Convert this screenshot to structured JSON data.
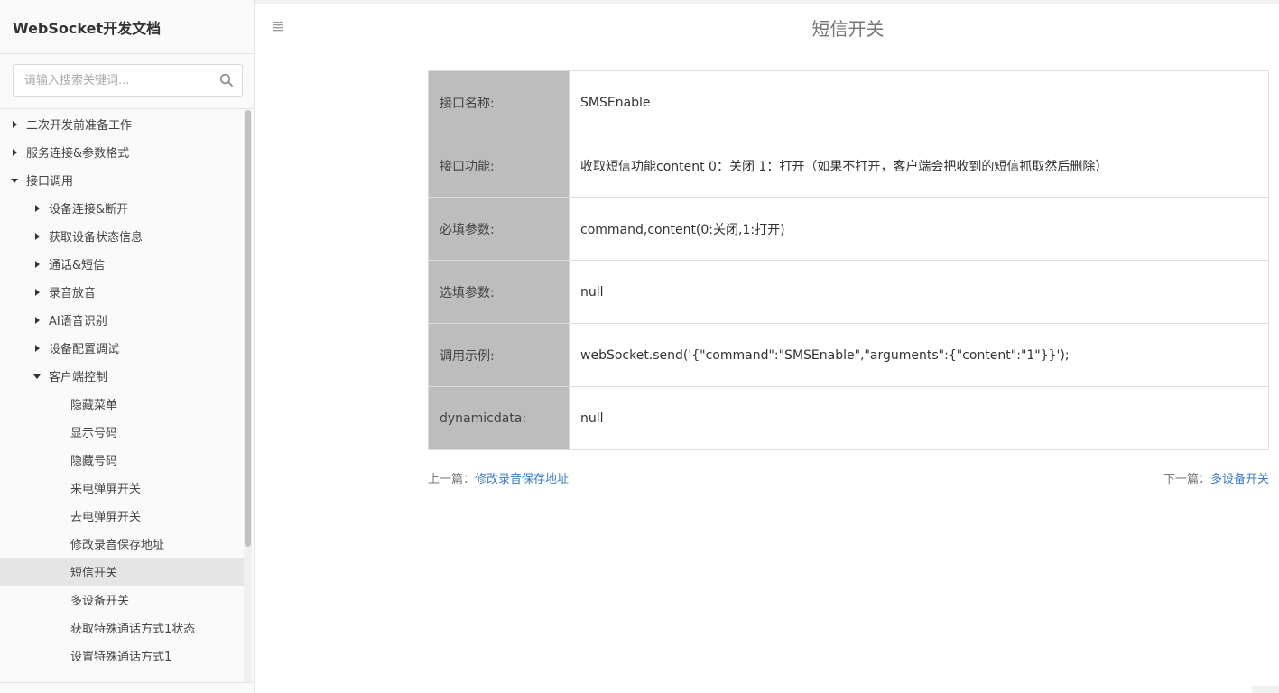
{
  "sidebar": {
    "title": "WebSocket开发文档",
    "search_placeholder": "请输入搜索关键词...",
    "items": [
      {
        "label": "二次开发前准备工作",
        "level": 0,
        "caret": "right"
      },
      {
        "label": "服务连接&参数格式",
        "level": 0,
        "caret": "right"
      },
      {
        "label": "接口调用",
        "level": 0,
        "caret": "down"
      },
      {
        "label": "设备连接&断开",
        "level": 1,
        "caret": "right"
      },
      {
        "label": "获取设备状态信息",
        "level": 1,
        "caret": "right"
      },
      {
        "label": "通话&短信",
        "level": 1,
        "caret": "right"
      },
      {
        "label": "录音放音",
        "level": 1,
        "caret": "right"
      },
      {
        "label": "AI语音识别",
        "level": 1,
        "caret": "right"
      },
      {
        "label": "设备配置调试",
        "level": 1,
        "caret": "right"
      },
      {
        "label": "客户端控制",
        "level": 1,
        "caret": "down"
      },
      {
        "label": "隐藏菜单",
        "level": 2,
        "caret": "none"
      },
      {
        "label": "显示号码",
        "level": 2,
        "caret": "none"
      },
      {
        "label": "隐藏号码",
        "level": 2,
        "caret": "none"
      },
      {
        "label": "来电弹屏开关",
        "level": 2,
        "caret": "none"
      },
      {
        "label": "去电弹屏开关",
        "level": 2,
        "caret": "none"
      },
      {
        "label": "修改录音保存地址",
        "level": 2,
        "caret": "none"
      },
      {
        "label": "短信开关",
        "level": 2,
        "caret": "none",
        "active": true
      },
      {
        "label": "多设备开关",
        "level": 2,
        "caret": "none"
      },
      {
        "label": "获取特殊通话方式1状态",
        "level": 2,
        "caret": "none"
      },
      {
        "label": "设置特殊通话方式1",
        "level": 2,
        "caret": "none"
      }
    ]
  },
  "main": {
    "title": "短信开关",
    "table": [
      {
        "label": "接口名称:",
        "value": "SMSEnable"
      },
      {
        "label": "接口功能:",
        "value": " 收取短信功能content 0：关闭 1：打开（如果不打开，客户端会把收到的短信抓取然后删除）"
      },
      {
        "label": "必填参数:",
        "value": "command,content(0:关闭,1:打开)"
      },
      {
        "label": "选填参数:",
        "value": "null"
      },
      {
        "label": "调用示例:",
        "value": "webSocket.send('{\"command\":\"SMSEnable\",\"arguments\":{\"content\":\"1\"}}');"
      },
      {
        "label": "dynamicdata:",
        "value": "null"
      }
    ],
    "prev_prefix": "上一篇：",
    "prev_link": "修改录音保存地址",
    "next_prefix": "下一篇：",
    "next_link": "多设备开关"
  },
  "colors": {
    "label_bg": "#bdbdbd",
    "link": "#3b7bbf",
    "active_bg": "#e5e5e5"
  }
}
